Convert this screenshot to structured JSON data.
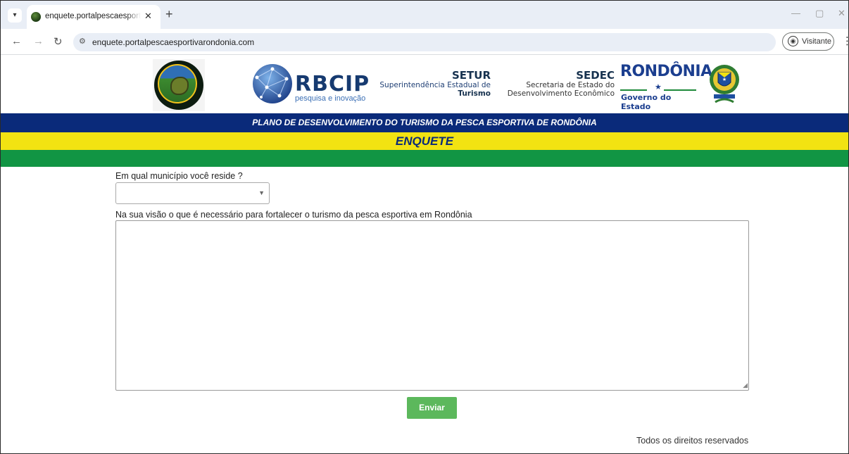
{
  "browser": {
    "tab_title": "enquete.portalpescaesportivarondonia.com",
    "tab_close": "✕",
    "new_tab": "+",
    "url": "enquete.portalpescaesportivarondonia.com",
    "profile_label": "Visitante",
    "icons": [
      "tab-search-icon",
      "back-icon",
      "forward-icon",
      "reload-icon",
      "site-settings-icon",
      "profile-icon",
      "menu-icon",
      "minimize-icon",
      "restore-icon",
      "close-icon"
    ]
  },
  "header": {
    "rbcip_name": "RBCIP",
    "rbcip_tagline": "pesquisa e inovação",
    "setur_title": "SETUR",
    "setur_line1": "Superintendência Estadual de",
    "setur_line2": "Turismo",
    "sedec_title": "SEDEC",
    "sedec_line1": "Secretaria de Estado do",
    "sedec_line2": "Desenvolvimento Econômico",
    "rondonia_title": "RONDÔNIA",
    "rondonia_subtitle": "Governo do Estado"
  },
  "banner": {
    "plan_title": "PLANO DE DESENVOLVIMENTO DO TURISMO DA PESCA ESPORTIVA DE RONDÔNIA",
    "section_title": "ENQUETE",
    "colors": {
      "blue": "#0a2a7a",
      "yellow": "#f2e312",
      "green": "#119544"
    }
  },
  "form": {
    "municipio_label": "Em qual município você reside ?",
    "municipio_value": "",
    "sugestao_label": "Na sua visão o que é necessário para fortalecer o turismo da pesca esportiva em Rondônia",
    "sugestao_value": "",
    "submit_label": "Enviar",
    "submit_color": "#5cb85c"
  },
  "footer": {
    "text": "Todos os direitos reservados"
  }
}
